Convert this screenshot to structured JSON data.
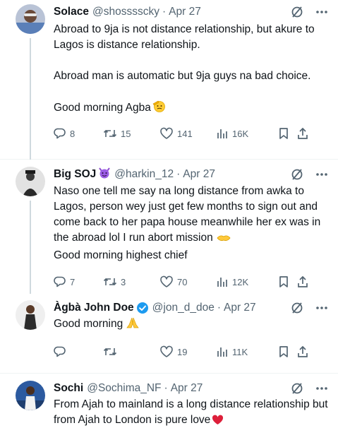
{
  "tweets": [
    {
      "name": "Solace",
      "handle": "@shosssscky",
      "time": "Apr 27",
      "text": "Abroad to 9ja is not distance relationship, but akure to Lagos is distance relationship.\n\nAbroad man is automatic but 9ja guys na bad choice.\n\nGood morning Agba",
      "replies": "8",
      "reposts": "15",
      "likes": "141",
      "views": "16K"
    },
    {
      "name": "Big SOJ",
      "handle": "@harkin_12",
      "time": "Apr 27",
      "text": "Naso one tell me say na long distance from awka to Lagos, person wey just get few months to sign out and come back to her papa house meanwhile her ex was in the abroad lol I run abort mission",
      "text2": "Good morning highest chief",
      "replies": "7",
      "reposts": "3",
      "likes": "70",
      "views": "12K"
    },
    {
      "name": "Àgbà John Doe",
      "handle": "@jon_d_doe",
      "time": "Apr 27",
      "text": "Good morning",
      "replies": "",
      "reposts": "",
      "likes": "19",
      "views": "11K"
    },
    {
      "name": "Sochi",
      "handle": "@Sochima_NF",
      "time": "Apr 27",
      "text": "From Ajah to mainland is a long distance relationship but from Ajah to London is pure love"
    }
  ],
  "dot": "·",
  "colors": {
    "text": "#0f1419",
    "secondary": "#536471",
    "verified": "#1d9bf0",
    "thread_line": "#cfd9de"
  }
}
